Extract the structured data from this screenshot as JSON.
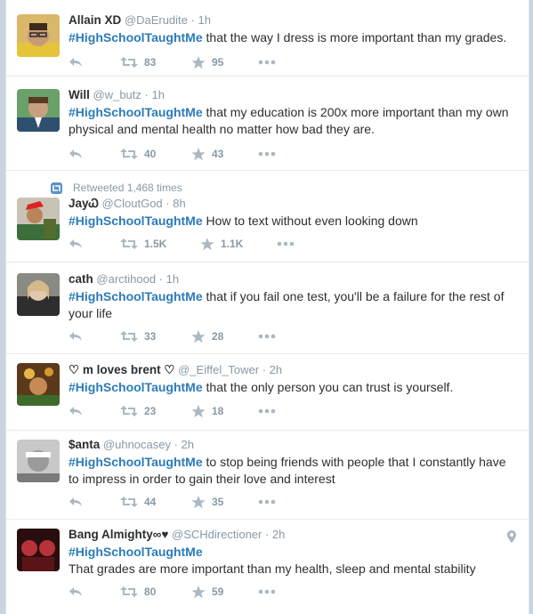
{
  "tweets": [
    {
      "name": "Allain XD",
      "handle": "@DaErudite",
      "time": "· 1h",
      "hashtag": "#HighSchoolTaughtMe",
      "text": " that the way I dress is more important than my grades.",
      "retweets": "83",
      "favorites": "95"
    },
    {
      "name": "Will",
      "handle": "@w_butz",
      "time": "· 1h",
      "hashtag": "#HighSchoolTaughtMe",
      "text": " that my education is 200x more important than my own physical and mental health no matter how bad they are.",
      "retweets": "40",
      "favorites": "43"
    },
    {
      "retweet_context": "Retweeted 1,468 times",
      "name": "Jay",
      "name_suffix": "Ꮗ",
      "handle": "@CloutGod",
      "time": "· 8h",
      "hashtag": "#HighSchoolTaughtMe",
      "text": " How to text without even looking down",
      "retweets": "1.5K",
      "favorites": "1.1K"
    },
    {
      "name": "cath",
      "handle": "@arctihood",
      "time": "· 1h",
      "hashtag": "#HighSchoolTaughtMe",
      "text": " that if you fail one test, you'll be a failure for the rest of your life",
      "retweets": "33",
      "favorites": "28"
    },
    {
      "name": "♡ m loves brent ♡",
      "handle": "@_Eiffel_Tower",
      "time": "· 2h",
      "hashtag": "#HighSchoolTaughtMe",
      "text": " that the only person you can trust is yourself.",
      "retweets": "23",
      "favorites": "18"
    },
    {
      "name": "$anta",
      "handle": "@uhnocasey",
      "time": "· 2h",
      "hashtag": "#HighSchoolTaughtMe",
      "text": " to stop being friends with people that I constantly have to impress in order to gain their love and interest",
      "retweets": "44",
      "favorites": "35"
    },
    {
      "name": "Bang Almighty∞♥",
      "handle": "@SCHdirectioner",
      "time": "· 2h",
      "hashtag": "#HighSchoolTaughtMe",
      "text": "That grades are more important than my health, sleep and mental stability",
      "retweets": "80",
      "favorites": "59"
    }
  ],
  "icons": {
    "reply": "reply-icon",
    "retweet": "retweet-icon",
    "favorite": "star-icon",
    "more": "more-icon",
    "location": "location-pin-icon",
    "retweeted": "retweeted-icon"
  },
  "colors": {
    "hashtag": "#2b7bb9",
    "name": "#292f33",
    "muted": "#8899a6",
    "background": "#c9d4de"
  }
}
